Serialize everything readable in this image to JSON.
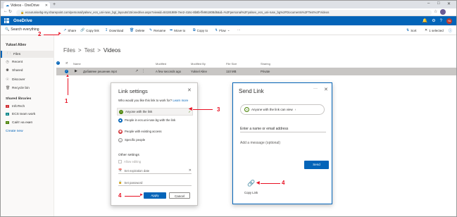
{
  "browser": {
    "tab_title": "Videos - OneDrive",
    "url": "ecourunisebg-my.sharepoint.com/personal/yalsev_ecs_uni-ruse_bg/_layouts/15/onedrive.aspx?viewid=84191989-7ee2-416c-8b8b-ffe961808d6&id=%2Fpersonal%2Fyalsev_ecs_uni-ruse_bg%2FDocuments%2FTest%2FVideos"
  },
  "app": {
    "name": "OneDrive",
    "user_initials": "YA"
  },
  "commandbar": {
    "search_placeholder": "Search everything",
    "share": "Share",
    "copy_link": "Copy link",
    "download": "Download",
    "delete": "Delete",
    "rename": "Rename",
    "move_to": "Move to",
    "copy_to": "Copy to",
    "flow": "Flow",
    "more": "···",
    "sort": "Sort",
    "selected": "1 selected"
  },
  "sidebar": {
    "user": "Yuksel Aliev",
    "items": [
      {
        "label": "Files",
        "icon": "folder-icon"
      },
      {
        "label": "Recent",
        "icon": "clock-icon"
      },
      {
        "label": "Shared",
        "icon": "people-icon"
      },
      {
        "label": "Discover",
        "icon": "globe-icon"
      },
      {
        "label": "Recycle bin",
        "icon": "trash-icon"
      }
    ],
    "shared_libraries_heading": "Shared libraries",
    "libraries": [
      {
        "label": "InfoTech",
        "color": "#d13438"
      },
      {
        "label": "ECS team work",
        "color": "#038387"
      },
      {
        "label": "Сайт на екип",
        "color": "#498205"
      }
    ],
    "create_new": "Create new"
  },
  "breadcrumb": {
    "parts": [
      "Files",
      ">",
      "Test",
      ">",
      "Videos"
    ]
  },
  "table": {
    "headers": {
      "name": "Name",
      "modified": "Modified",
      "modified_by": "Modified By",
      "file_size": "File Size",
      "sharing": "Sharing"
    },
    "rows": [
      {
        "name": "Добавяне решение.mp4",
        "modified": "A few seconds ago",
        "modified_by": "Yuksel Aliev",
        "file_size": "110 MB",
        "sharing": "Private"
      }
    ]
  },
  "link_settings": {
    "title": "Link settings",
    "question": "Who would you like this link to work for?",
    "learn_more": "Learn more",
    "options": [
      {
        "label": "Anyone with the link",
        "color": "#498205"
      },
      {
        "label": "People in ecs.uni-ruse.bg with the link",
        "color": "#0364b8"
      },
      {
        "label": "People with existing access",
        "color": "#d13438"
      },
      {
        "label": "Specific people",
        "color": "#8a8886"
      }
    ],
    "other_settings": "Other settings",
    "allow_editing": "Allow editing",
    "expiration": "Set expiration date",
    "password": "Set password",
    "apply": "Apply",
    "cancel": "Cancel"
  },
  "send_link": {
    "title": "Send Link",
    "more": "···",
    "scope": "Anyone with the link can view",
    "name_placeholder": "Enter a name or email address",
    "message_placeholder": "Add a message (optional)",
    "send": "Send",
    "copy_link": "Copy Link"
  },
  "annotations": [
    "1",
    "2",
    "3",
    "4",
    "4"
  ],
  "colors": {
    "accent": "#0364b8",
    "annotation": "#e81123"
  }
}
